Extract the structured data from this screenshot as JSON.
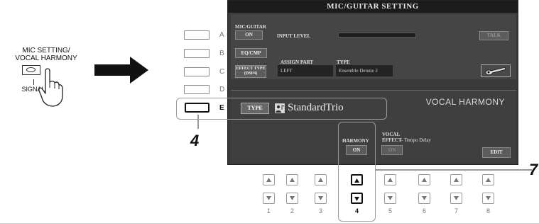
{
  "panel": {
    "label_line1": "MIC SETTING/",
    "label_line2": "VOCAL HARMONY",
    "sub_label": "SIGNAL"
  },
  "side_buttons": [
    "A",
    "B",
    "C",
    "D",
    "E"
  ],
  "screen": {
    "title": "MIC/GUITAR SETTING",
    "mic_guitar_label": "MIC/GUITAR",
    "on_label": "ON",
    "input_level_label": "INPUT LEVEL",
    "talk_label": "TALK",
    "eq_cmp_label": "EQ/CMP",
    "effect_type_line1": "EFFECT TYPE",
    "effect_type_line2": "(DSP4)",
    "assign_part_label": "ASSIGN PART",
    "assign_part_value": "LEFT",
    "type_header": "TYPE",
    "type_value": "Ensemble Detune 2",
    "type_button": "TYPE",
    "harmony_preset": "StandardTrio",
    "vocal_harmony_title": "VOCAL HARMONY",
    "harmony_label": "HARMONY",
    "harmony_on": "ON",
    "vocal_effect_line1": "VOCAL",
    "vocal_effect_line2": "EFFECT",
    "vocal_effect_value": "– Tempo Delay",
    "vocal_effect_on": "ON",
    "edit_label": "EDIT"
  },
  "bottom_buttons": [
    "1",
    "2",
    "3",
    "4",
    "5",
    "6",
    "7",
    "8"
  ],
  "highlighted_column": "4",
  "steps": {
    "left": "4",
    "right": "7"
  }
}
